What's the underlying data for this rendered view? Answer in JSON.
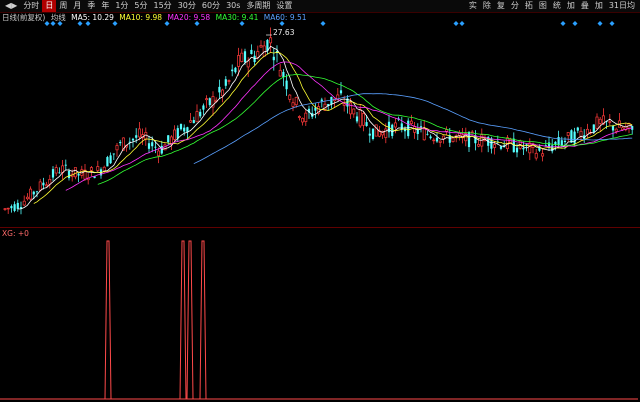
{
  "toolbar": {
    "items": [
      {
        "label": "◀▶",
        "active": false
      },
      {
        "label": "分时",
        "active": false
      },
      {
        "label": "日",
        "active": true
      },
      {
        "label": "周",
        "active": false
      },
      {
        "label": "月",
        "active": false
      },
      {
        "label": "季",
        "active": false
      },
      {
        "label": "年",
        "active": false
      },
      {
        "label": "1分",
        "active": false
      },
      {
        "label": "5分",
        "active": false
      },
      {
        "label": "15分",
        "active": false
      },
      {
        "label": "30分",
        "active": false
      },
      {
        "label": "60分",
        "active": false
      },
      {
        "label": "30s",
        "active": false
      },
      {
        "label": "多周期",
        "active": false
      },
      {
        "label": "设置",
        "active": false
      }
    ],
    "right_items": [
      "实",
      "除",
      "复",
      "分",
      "拓",
      "图",
      "统",
      "加",
      "叠",
      "加",
      "31日均"
    ]
  },
  "legend": {
    "stock_label": "日线(前复权)",
    "indicator": "均线",
    "ma5": "MA5: 10.29",
    "ma10": "MA10: 9.98",
    "ma20": "MA20: 9.58",
    "ma30": "MA30: 9.41",
    "ma60": "MA60: 9.51"
  },
  "peak": {
    "label": "27.63"
  },
  "indicator_panel": {
    "label": "XG: +0"
  },
  "colors": {
    "up": "#ff3a3a",
    "down": "#54ffff",
    "ma5": "#ffffff",
    "ma10": "#ffff33",
    "ma20": "#ff33ff",
    "ma30": "#33ff33",
    "ma60": "#5aa0ff",
    "xg_line": "#ff4a4a",
    "marker": "#2aa0ff"
  },
  "chart_data": {
    "type": "candlestick",
    "peak_value": 27.63,
    "xg_signal_positions": [
      108,
      183,
      190,
      203
    ]
  }
}
